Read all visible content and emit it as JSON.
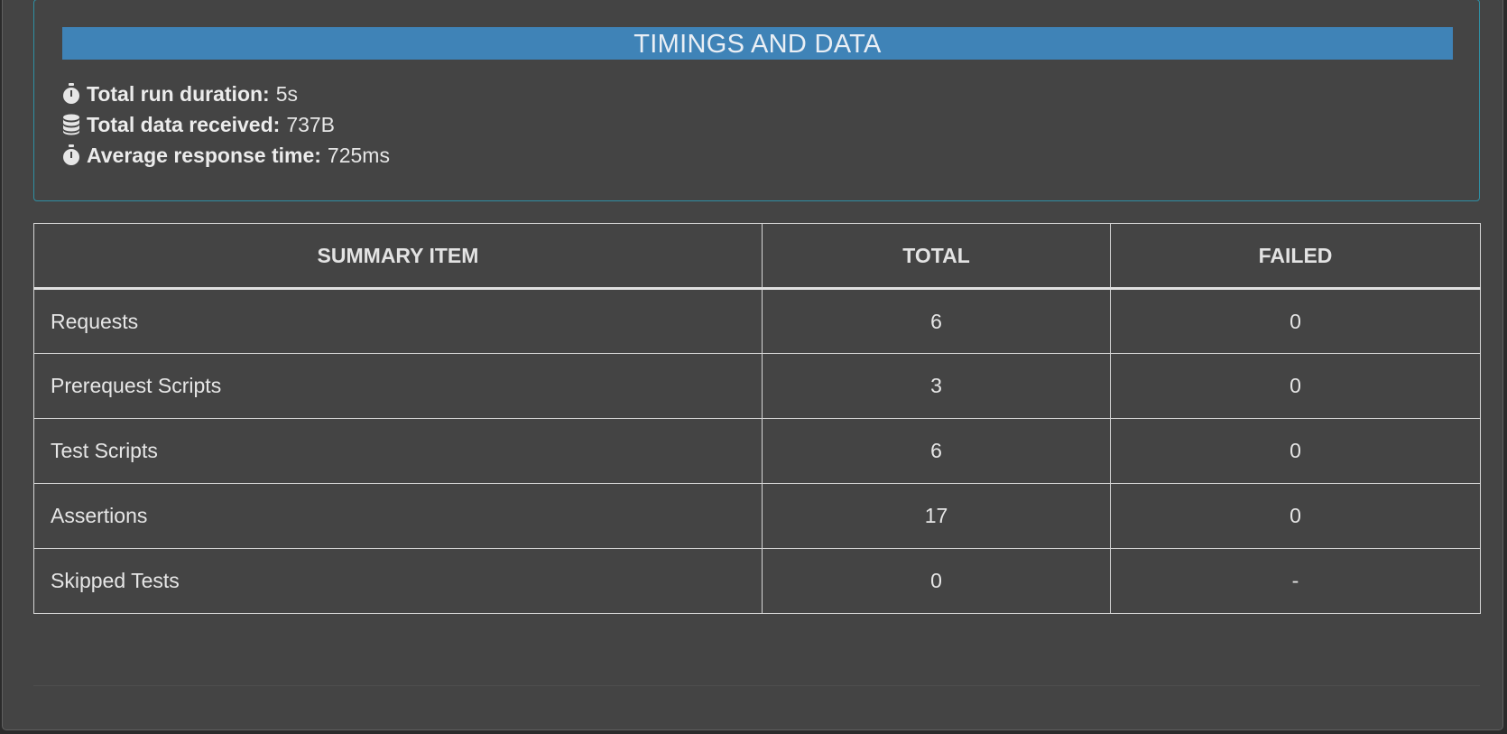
{
  "timings": {
    "title": "TIMINGS AND DATA",
    "stats": [
      {
        "icon": "stopwatch-icon",
        "label": "Total run duration:",
        "value": "5s"
      },
      {
        "icon": "database-icon",
        "label": "Total data received:",
        "value": "737B"
      },
      {
        "icon": "stopwatch-icon",
        "label": "Average response time:",
        "value": "725ms"
      }
    ]
  },
  "summary": {
    "headers": [
      "SUMMARY ITEM",
      "TOTAL",
      "FAILED"
    ],
    "rows": [
      {
        "item": "Requests",
        "total": "6",
        "failed": "0"
      },
      {
        "item": "Prerequest Scripts",
        "total": "3",
        "failed": "0"
      },
      {
        "item": "Test Scripts",
        "total": "6",
        "failed": "0"
      },
      {
        "item": "Assertions",
        "total": "17",
        "failed": "0"
      },
      {
        "item": "Skipped Tests",
        "total": "0",
        "failed": "-"
      }
    ]
  },
  "colors": {
    "background": "#444444",
    "title_bar": "#3f83b7",
    "card_border": "#2f8fa3",
    "table_border": "#d6d6d6"
  }
}
